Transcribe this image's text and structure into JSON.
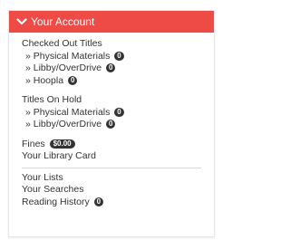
{
  "header": {
    "title": "Your Account",
    "icon": "chevron-down-icon",
    "color": "#ee4b46"
  },
  "checked_out": {
    "title": "Checked Out Titles",
    "items": [
      {
        "label": "» Physical Materials",
        "count": "0"
      },
      {
        "label": "» Libby/OverDrive",
        "count": "0"
      },
      {
        "label": "» Hoopla",
        "count": "0"
      }
    ]
  },
  "on_hold": {
    "title": "Titles On Hold",
    "items": [
      {
        "label": "» Physical Materials",
        "count": "0"
      },
      {
        "label": "» Libby/OverDrive",
        "count": "0"
      }
    ]
  },
  "fines": {
    "label": "Fines",
    "amount": "$0.00"
  },
  "library_card": "Your Library Card",
  "lists": "Your Lists",
  "searches": "Your Searches",
  "reading_history": {
    "label": "Reading History",
    "count": "0"
  }
}
